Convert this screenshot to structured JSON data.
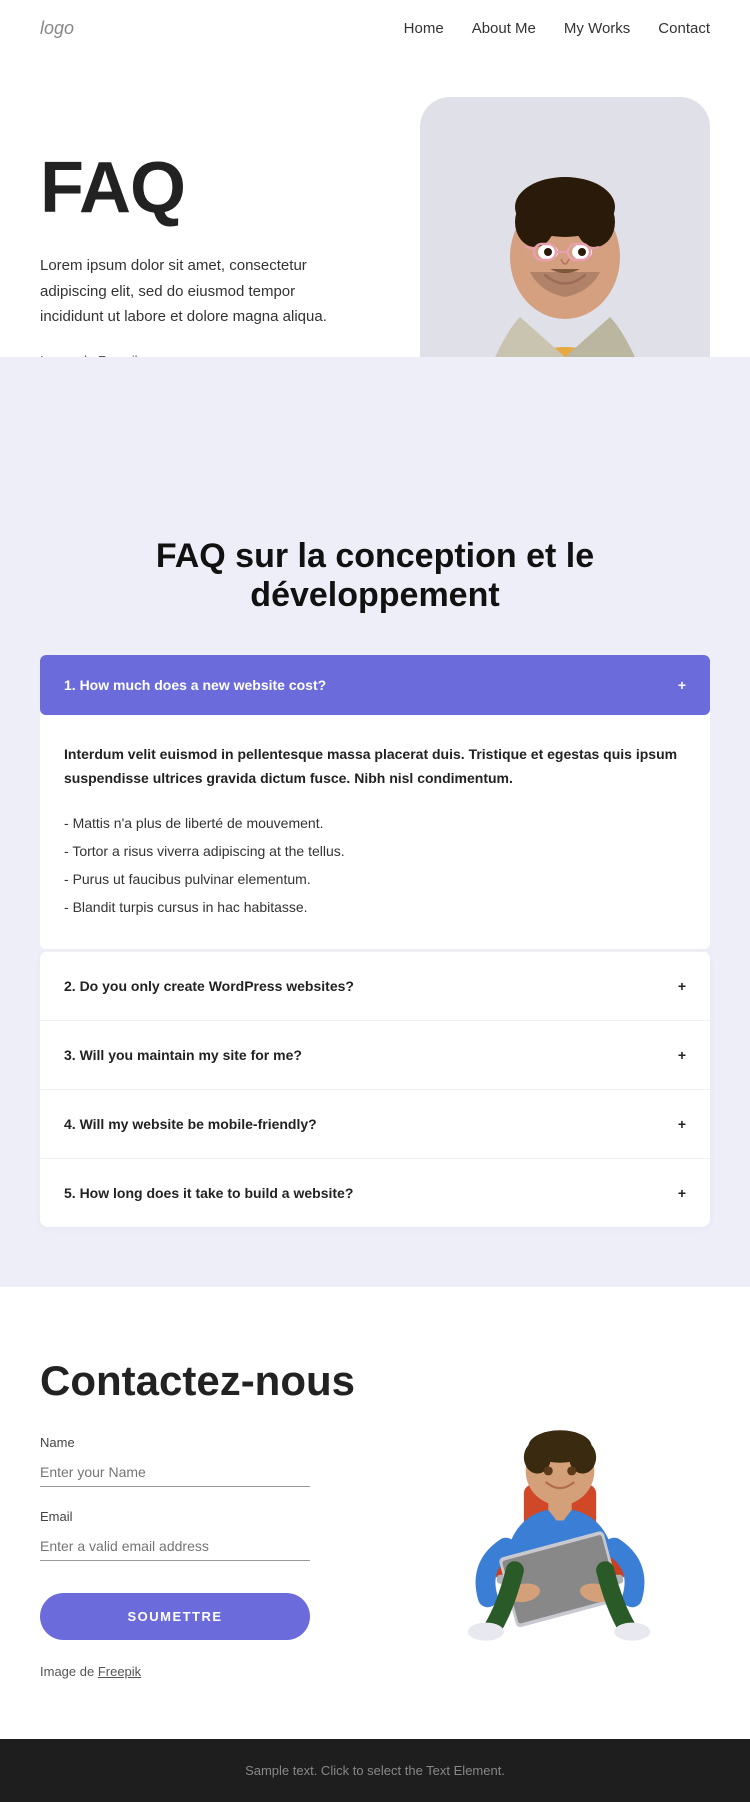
{
  "nav": {
    "logo": "logo",
    "links": [
      {
        "label": "Home",
        "name": "nav-home"
      },
      {
        "label": "About Me",
        "name": "nav-about"
      },
      {
        "label": "My Works",
        "name": "nav-works"
      },
      {
        "label": "Contact",
        "name": "nav-contact"
      }
    ]
  },
  "hero": {
    "title": "FAQ",
    "description": "Lorem ipsum dolor sit amet, consectetur adipiscing elit, sed do eiusmod tempor incididunt ut labore et dolore magna aliqua.",
    "image_credit_prefix": "Image de ",
    "image_credit_link": "Freepik"
  },
  "faq_section": {
    "heading": "FAQ sur la conception et le développement",
    "items": [
      {
        "id": 1,
        "question": "1. How much does a new website cost?",
        "open": true,
        "answer_bold": "Interdum velit euismod in pellentesque massa placerat duis. Tristique et egestas quis ipsum suspendisse ultrices gravida dictum fusce. Nibh nisl condimentum.",
        "bullets": [
          "Mattis n'a plus de liberté de mouvement.",
          "Tortor a risus viverra adipiscing at the tellus.",
          "Purus ut faucibus pulvinar elementum.",
          "Blandit turpis cursus in hac habitasse."
        ]
      },
      {
        "id": 2,
        "question": "2. Do you only create WordPress websites?",
        "open": false
      },
      {
        "id": 3,
        "question": "3. Will you maintain my site for me?",
        "open": false
      },
      {
        "id": 4,
        "question": "4. Will my website be mobile-friendly?",
        "open": false
      },
      {
        "id": 5,
        "question": "5. How long does it take to build a website?",
        "open": false
      }
    ]
  },
  "contact": {
    "heading": "Contactez-nous",
    "name_label": "Name",
    "name_placeholder": "Enter your Name",
    "email_label": "Email",
    "email_placeholder": "Enter a valid email address",
    "submit_label": "SOUMETTRE",
    "image_credit_prefix": "Image de ",
    "image_credit_link": "Freepik"
  },
  "footer": {
    "text": "Sample text. Click to select the Text Element."
  }
}
